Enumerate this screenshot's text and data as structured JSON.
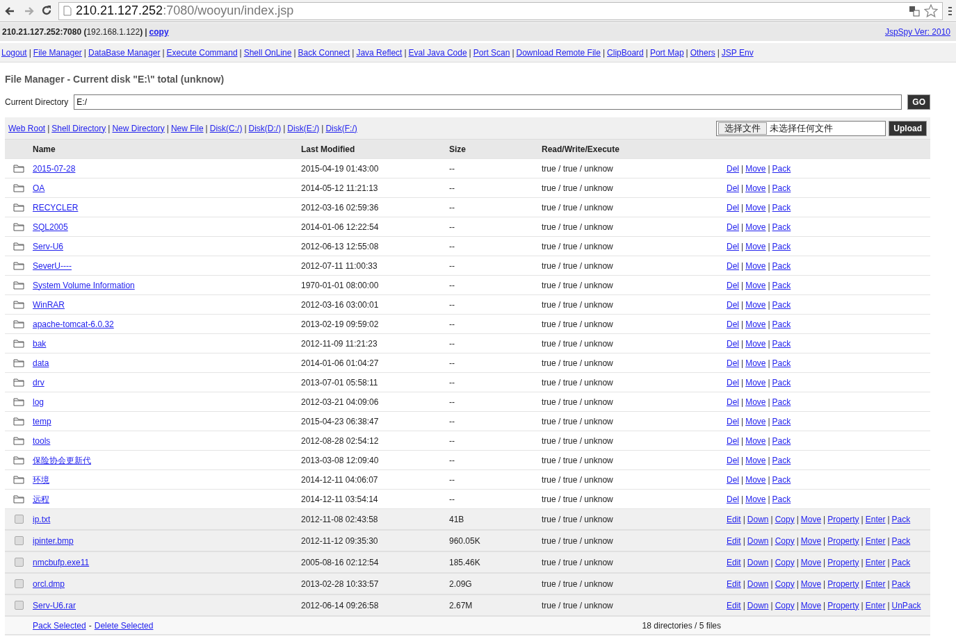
{
  "browser": {
    "url_host": "210.21.127.252",
    "url_path": ":7080/wooyun/index.jsp"
  },
  "info_bar": {
    "server": "**210.21.127.252:7080 (**192.168.1.122**)**",
    "separator": "|",
    "copy_link": "copy",
    "version_link": "JspSpy Ver: 2010"
  },
  "link_separator": "|",
  "nav_links": [
    "Logout",
    "File Manager",
    "DataBase Manager",
    "Execute Command",
    "Shell OnLine",
    "Back Connect",
    "Java Reflect",
    "Eval Java Code",
    "Port Scan",
    "Download Remote File",
    "ClipBoard",
    "Port Map",
    "Others",
    "JSP Env"
  ],
  "title": "File Manager - Current disk \"E:\\\" total (unknow)",
  "directory": {
    "label": "Current Directory",
    "value": "E:/",
    "button": "GO"
  },
  "toolbar_links": [
    "Web Root",
    "Shell Directory",
    "New Directory",
    "New File",
    "Disk(C:/)",
    "Disk(D:/)",
    "Disk(E:/)",
    "Disk(F:/)"
  ],
  "upload": {
    "choose_button": "选择文件",
    "no_file": "未选择任何文件",
    "button": "Upload"
  },
  "table": {
    "columns": [
      "Name",
      "Last Modified",
      "Size",
      "Read/Write/Execute"
    ],
    "rows": [
      {
        "kind": "folder",
        "name": "2015-07-28",
        "modified": "2015-04-19 01:43:00",
        "size": "--",
        "rwx": "true / true / unknow",
        "actions": [
          "Del",
          "Move",
          "Pack"
        ]
      },
      {
        "kind": "folder",
        "name": "OA",
        "modified": "2014-05-12 11:21:13",
        "size": "--",
        "rwx": "true / true / unknow",
        "actions": [
          "Del",
          "Move",
          "Pack"
        ]
      },
      {
        "kind": "folder",
        "name": "RECYCLER",
        "modified": "2012-03-16 02:59:36",
        "size": "--",
        "rwx": "true / true / unknow",
        "actions": [
          "Del",
          "Move",
          "Pack"
        ]
      },
      {
        "kind": "folder",
        "name": "SQL2005",
        "modified": "2014-01-06 12:22:54",
        "size": "--",
        "rwx": "true / true / unknow",
        "actions": [
          "Del",
          "Move",
          "Pack"
        ]
      },
      {
        "kind": "folder",
        "name": "Serv-U6",
        "modified": "2012-06-13 12:55:08",
        "size": "--",
        "rwx": "true / true / unknow",
        "actions": [
          "Del",
          "Move",
          "Pack"
        ]
      },
      {
        "kind": "folder",
        "name": "SeverU----",
        "modified": "2012-07-11 11:00:33",
        "size": "--",
        "rwx": "true / true / unknow",
        "actions": [
          "Del",
          "Move",
          "Pack"
        ]
      },
      {
        "kind": "folder",
        "name": "System Volume Information",
        "modified": "1970-01-01 08:00:00",
        "size": "--",
        "rwx": "true / true / unknow",
        "actions": [
          "Del",
          "Move",
          "Pack"
        ]
      },
      {
        "kind": "folder",
        "name": "WinRAR",
        "modified": "2012-03-16 03:00:01",
        "size": "--",
        "rwx": "true / true / unknow",
        "actions": [
          "Del",
          "Move",
          "Pack"
        ]
      },
      {
        "kind": "folder",
        "name": "apache-tomcat-6.0.32",
        "modified": "2013-02-19 09:59:02",
        "size": "--",
        "rwx": "true / true / unknow",
        "actions": [
          "Del",
          "Move",
          "Pack"
        ]
      },
      {
        "kind": "folder",
        "name": "bak",
        "modified": "2012-11-09 11:21:23",
        "size": "--",
        "rwx": "true / true / unknow",
        "actions": [
          "Del",
          "Move",
          "Pack"
        ]
      },
      {
        "kind": "folder",
        "name": "data",
        "modified": "2014-01-06 01:04:27",
        "size": "--",
        "rwx": "true / true / unknow",
        "actions": [
          "Del",
          "Move",
          "Pack"
        ]
      },
      {
        "kind": "folder",
        "name": "drv",
        "modified": "2013-07-01 05:58:11",
        "size": "--",
        "rwx": "true / true / unknow",
        "actions": [
          "Del",
          "Move",
          "Pack"
        ]
      },
      {
        "kind": "folder",
        "name": "log",
        "modified": "2012-03-21 04:09:06",
        "size": "--",
        "rwx": "true / true / unknow",
        "actions": [
          "Del",
          "Move",
          "Pack"
        ]
      },
      {
        "kind": "folder",
        "name": "temp",
        "modified": "2015-04-23 06:38:47",
        "size": "--",
        "rwx": "true / true / unknow",
        "actions": [
          "Del",
          "Move",
          "Pack"
        ]
      },
      {
        "kind": "folder",
        "name": "tools",
        "modified": "2012-08-28 02:54:12",
        "size": "--",
        "rwx": "true / true / unknow",
        "actions": [
          "Del",
          "Move",
          "Pack"
        ]
      },
      {
        "kind": "folder",
        "name": "保险协会更新代",
        "modified": "2013-03-08 12:09:40",
        "size": "--",
        "rwx": "true / true / unknow",
        "actions": [
          "Del",
          "Move",
          "Pack"
        ]
      },
      {
        "kind": "folder",
        "name": "环境",
        "modified": "2014-12-11 04:06:07",
        "size": "--",
        "rwx": "true / true / unknow",
        "actions": [
          "Del",
          "Move",
          "Pack"
        ]
      },
      {
        "kind": "folder",
        "name": "远程",
        "modified": "2014-12-11 03:54:14",
        "size": "--",
        "rwx": "true / true / unknow",
        "actions": [
          "Del",
          "Move",
          "Pack"
        ]
      },
      {
        "kind": "file",
        "checked": false,
        "name": "ip.txt",
        "modified": "2012-11-08 02:43:58",
        "size": "41B",
        "rwx": "true / true / unknow",
        "actions": [
          "Edit",
          "Down",
          "Copy",
          "Move",
          "Property",
          "Enter",
          "Pack"
        ]
      },
      {
        "kind": "file",
        "checked": false,
        "name": "ipinter.bmp",
        "modified": "2012-11-12 09:35:30",
        "size": "960.05K",
        "rwx": "true / true / unknow",
        "actions": [
          "Edit",
          "Down",
          "Copy",
          "Move",
          "Property",
          "Enter",
          "Pack"
        ]
      },
      {
        "kind": "file",
        "checked": false,
        "name": "nmcbufp.exe11",
        "modified": "2005-08-16 02:12:54",
        "size": "185.46K",
        "rwx": "true / true / unknow",
        "actions": [
          "Edit",
          "Down",
          "Copy",
          "Move",
          "Property",
          "Enter",
          "Pack"
        ]
      },
      {
        "kind": "file",
        "checked": false,
        "name": "orcl.dmp",
        "modified": "2013-02-28 10:33:57",
        "size": "2.09G",
        "rwx": "true / true / unknow",
        "actions": [
          "Edit",
          "Down",
          "Copy",
          "Move",
          "Property",
          "Enter",
          "Pack"
        ]
      },
      {
        "kind": "file",
        "checked": false,
        "name": "Serv-U6.rar",
        "modified": "2012-06-14 09:26:58",
        "size": "2.67M",
        "rwx": "true / true / unknow",
        "actions": [
          "Edit",
          "Down",
          "Copy",
          "Move",
          "Property",
          "Enter",
          "UnPack"
        ]
      }
    ]
  },
  "footer": {
    "pack_selected": "Pack Selected",
    "separator": "-",
    "delete_selected": "Delete Selected",
    "summary": "18 directories / 5 files"
  }
}
